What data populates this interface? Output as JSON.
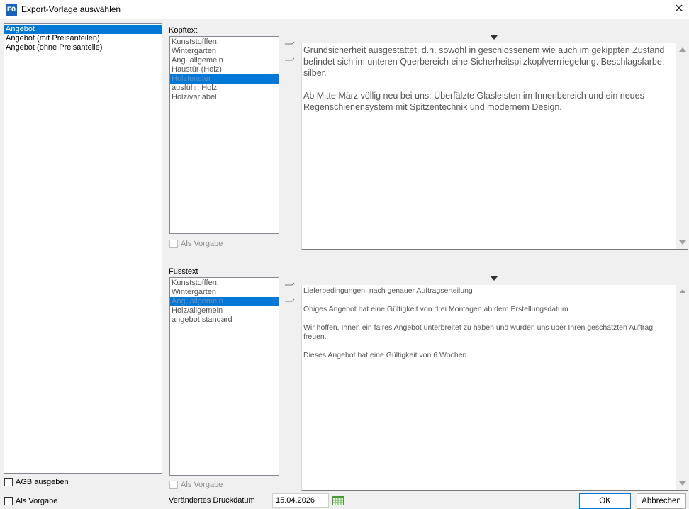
{
  "window": {
    "title": "Export-Vorlage auswählen",
    "icon_text": "F0",
    "close_glyph": "✕"
  },
  "templates": {
    "items": [
      "Angebot",
      "Angebot (mit Preisanteilen)",
      "Angebot (ohne Preisanteile)"
    ],
    "selected_index": 0
  },
  "agb_checkbox": {
    "label": "AGB ausgeben",
    "checked": false
  },
  "als_vorgabe_main": {
    "label": "Als Vorgabe",
    "checked": false
  },
  "kopftext": {
    "label": "Kopftext",
    "items": [
      "Kunststofffen.",
      "Wintergarten",
      "Ang. allgemein",
      "Haustür (Holz)",
      "Holzfenster",
      "ausführ. Holz",
      "Holz/variabel"
    ],
    "selected_index": 4,
    "als_vorgabe": "Als Vorgabe",
    "text": "Grundsicherheit ausgestattet, d.h. sowohl in geschlossenem wie auch im gekippten Zustand befindet sich im unteren Querbereich eine Sicherheitspilzkopfverrriegelung. Beschlagsfarbe: silber.\n\nAb Mitte März völlig neu bei uns: Überfälzte Glasleisten im Innenbereich und ein neues Regenschienensystem mit Spitzentechnik und modernem Design."
  },
  "fusstext": {
    "label": "Fusstext",
    "items": [
      "Kunststofffen.",
      "Wintergarten",
      "Ang. allgemein",
      "Holz/allgemein",
      "angebot standard"
    ],
    "selected_index": 2,
    "als_vorgabe": "Als Vorgabe",
    "text": "Lieferbedingungen: nach genauer Auftragserteilung\n\nObiges Angebot hat eine Gültigkeit von drei Montagen ab dem Erstellungsdatum.\n\nWir hoffen, Ihnen ein faires Angebot unterbreitet zu haben und würden uns über Ihren geschätzten Auftrag freuen.\n\nDieses Angebot hat eine Gültigkeit von 6 Wochen."
  },
  "druckdatum": {
    "label": "Verändertes Druckdatum",
    "value": "15.04.2026"
  },
  "buttons": {
    "ok": "OK",
    "cancel": "Abbrechen"
  },
  "icons": {
    "calendar": "calendar-icon",
    "insert_arrow": "insert-arrow-icon",
    "dropdown": "chevron-down-icon"
  }
}
